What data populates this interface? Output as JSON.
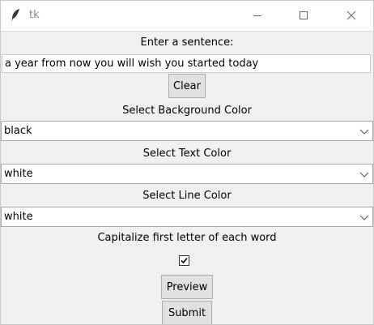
{
  "window": {
    "title": "tk"
  },
  "form": {
    "sentence_label": "Enter a sentence:",
    "sentence_value": "a year from now you will wish you started today",
    "clear_label": "Clear",
    "bg_label": "Select Background Color",
    "bg_value": "black",
    "text_label": "Select Text Color",
    "text_value": "white",
    "line_label": "Select Line Color",
    "line_value": "white",
    "capitalize_label": "Capitalize first letter of each word",
    "capitalize_checked": true,
    "preview_label": "Preview",
    "submit_label": "Submit"
  },
  "icons": {
    "app": "feather-icon",
    "minimize": "minimize-icon",
    "maximize": "maximize-icon",
    "close": "close-icon",
    "dropdown": "chevron-down-icon",
    "check": "checkmark-icon"
  }
}
